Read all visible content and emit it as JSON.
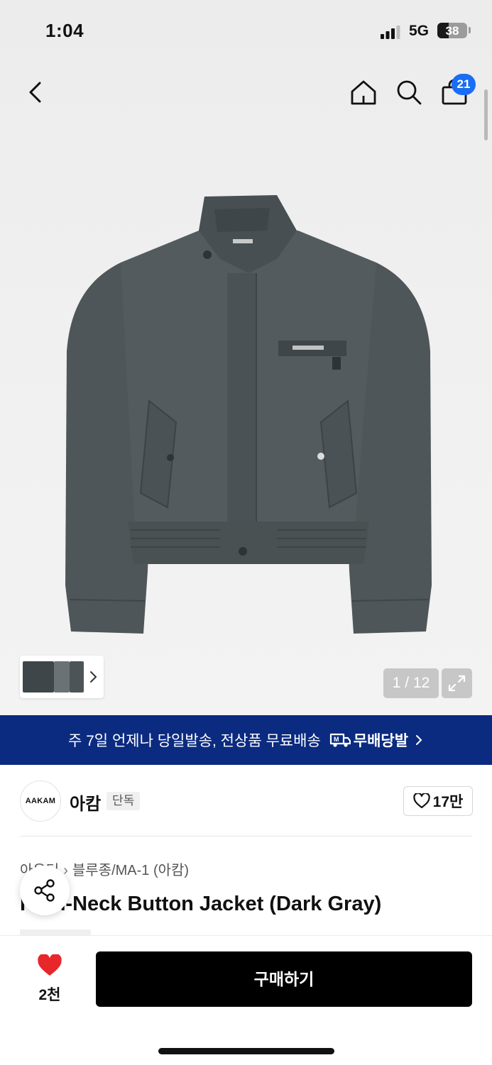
{
  "status_bar": {
    "time": "1:04",
    "network": "5G",
    "battery": "38",
    "battery_level_percent": 38
  },
  "top_nav": {
    "cart_count": "21"
  },
  "gallery": {
    "counter": "1 / 12",
    "current_index": 1,
    "total": 12
  },
  "banner": {
    "text": "주 7일 언제나 당일발송, 전상품 무료배송",
    "brand_text": "무배당발"
  },
  "brand": {
    "logo_text": "AAKAM",
    "name": "아캄",
    "exclusive_label": "단독",
    "likes": "17만"
  },
  "product": {
    "breadcrumb": [
      "아우터",
      "블루종/MA-1 (아캄)"
    ],
    "title": "High-Neck Button Jacket (Dark Gray)"
  },
  "bottom_bar": {
    "wish_count": "2천",
    "buy_label": "구매하기"
  },
  "colors": {
    "banner_bg": "#0b2b80",
    "badge_blue": "#1a6df5",
    "heart_red": "#e8272a",
    "jacket_gray": "#4e5659"
  }
}
